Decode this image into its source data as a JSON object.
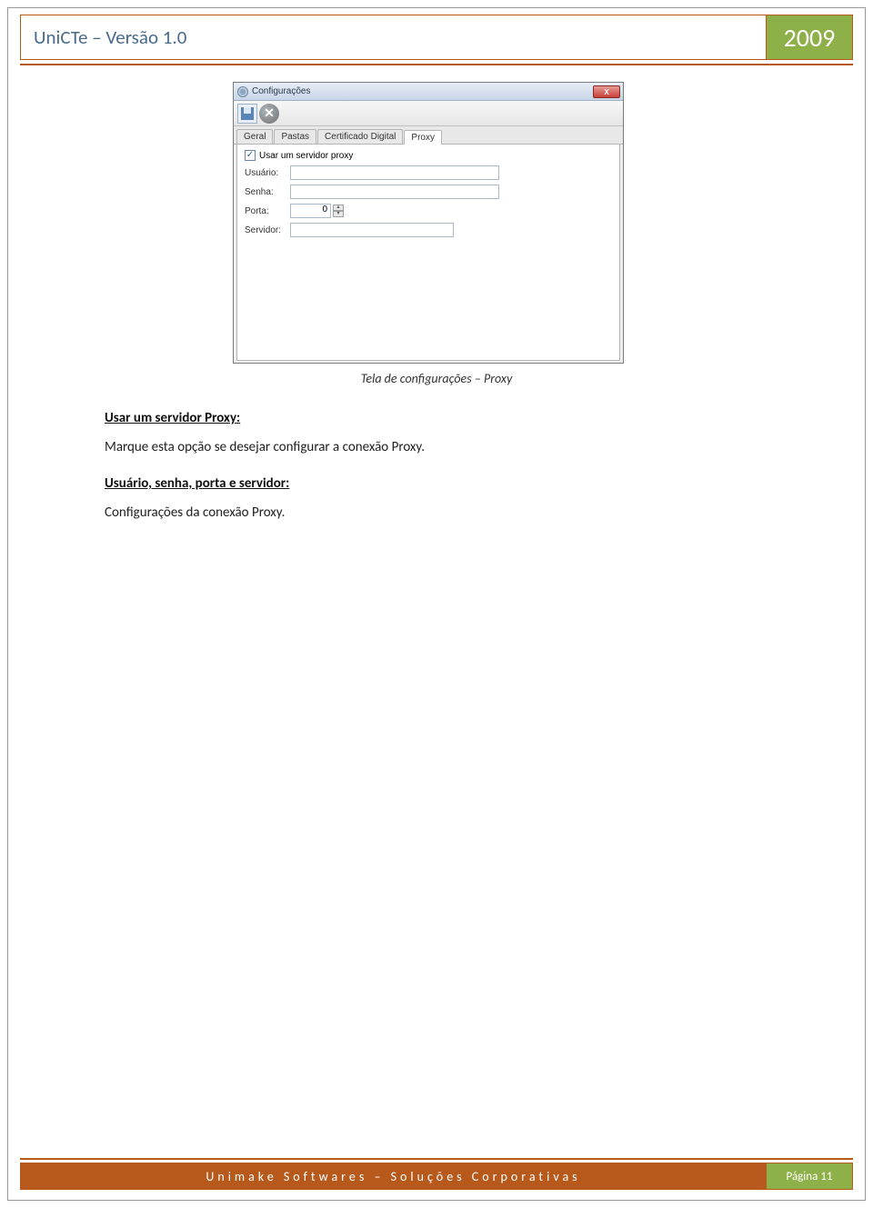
{
  "header": {
    "title": "UniCTe – Versão 1.0",
    "year": "2009"
  },
  "window": {
    "title": "Configurações",
    "close_x": "X",
    "cancel_x": "✕",
    "tabs": [
      "Geral",
      "Pastas",
      "Certificado Digital",
      "Proxy"
    ],
    "active_tab_index": 3,
    "proxy": {
      "checkbox_label": "Usar um servidor proxy",
      "checked": "✓",
      "usuario_label": "Usuário:",
      "senha_label": "Senha:",
      "porta_label": "Porta:",
      "porta_value": "0",
      "servidor_label": "Servidor:",
      "spin_up": "▴",
      "spin_down": "▾"
    }
  },
  "caption": "Tela de configurações – Proxy",
  "section1_title": "Usar um servidor Proxy:",
  "section1_text": "Marque esta opção se desejar configurar a conexão Proxy.",
  "section2_title": "Usuário, senha, porta e servidor:",
  "section2_text": "Configurações da conexão Proxy.",
  "footer": {
    "company": "Unimake Softwares – Soluções Corporativas",
    "page": "Página 11"
  }
}
